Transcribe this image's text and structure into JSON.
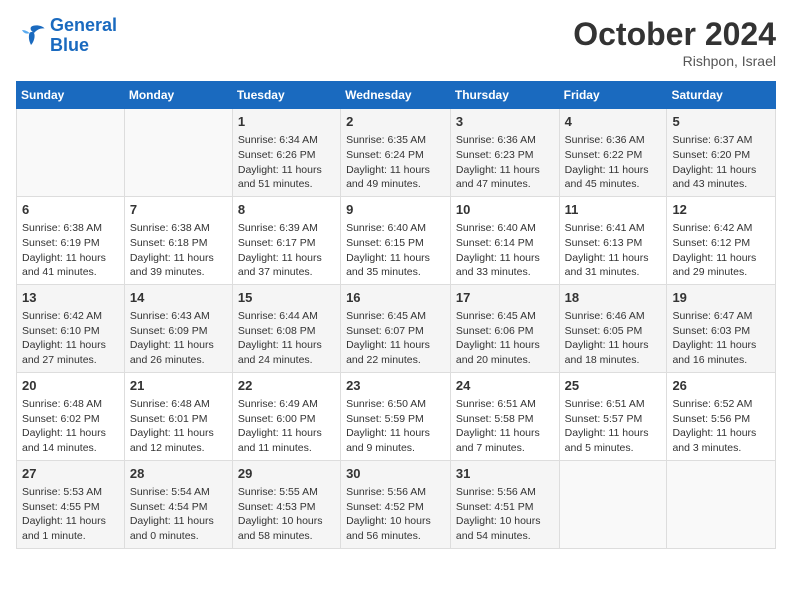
{
  "header": {
    "logo_line1": "General",
    "logo_line2": "Blue",
    "month_year": "October 2024",
    "location": "Rishpon, Israel"
  },
  "weekdays": [
    "Sunday",
    "Monday",
    "Tuesday",
    "Wednesday",
    "Thursday",
    "Friday",
    "Saturday"
  ],
  "weeks": [
    [
      {
        "day": "",
        "content": ""
      },
      {
        "day": "",
        "content": ""
      },
      {
        "day": "1",
        "content": "Sunrise: 6:34 AM\nSunset: 6:26 PM\nDaylight: 11 hours and 51 minutes."
      },
      {
        "day": "2",
        "content": "Sunrise: 6:35 AM\nSunset: 6:24 PM\nDaylight: 11 hours and 49 minutes."
      },
      {
        "day": "3",
        "content": "Sunrise: 6:36 AM\nSunset: 6:23 PM\nDaylight: 11 hours and 47 minutes."
      },
      {
        "day": "4",
        "content": "Sunrise: 6:36 AM\nSunset: 6:22 PM\nDaylight: 11 hours and 45 minutes."
      },
      {
        "day": "5",
        "content": "Sunrise: 6:37 AM\nSunset: 6:20 PM\nDaylight: 11 hours and 43 minutes."
      }
    ],
    [
      {
        "day": "6",
        "content": "Sunrise: 6:38 AM\nSunset: 6:19 PM\nDaylight: 11 hours and 41 minutes."
      },
      {
        "day": "7",
        "content": "Sunrise: 6:38 AM\nSunset: 6:18 PM\nDaylight: 11 hours and 39 minutes."
      },
      {
        "day": "8",
        "content": "Sunrise: 6:39 AM\nSunset: 6:17 PM\nDaylight: 11 hours and 37 minutes."
      },
      {
        "day": "9",
        "content": "Sunrise: 6:40 AM\nSunset: 6:15 PM\nDaylight: 11 hours and 35 minutes."
      },
      {
        "day": "10",
        "content": "Sunrise: 6:40 AM\nSunset: 6:14 PM\nDaylight: 11 hours and 33 minutes."
      },
      {
        "day": "11",
        "content": "Sunrise: 6:41 AM\nSunset: 6:13 PM\nDaylight: 11 hours and 31 minutes."
      },
      {
        "day": "12",
        "content": "Sunrise: 6:42 AM\nSunset: 6:12 PM\nDaylight: 11 hours and 29 minutes."
      }
    ],
    [
      {
        "day": "13",
        "content": "Sunrise: 6:42 AM\nSunset: 6:10 PM\nDaylight: 11 hours and 27 minutes."
      },
      {
        "day": "14",
        "content": "Sunrise: 6:43 AM\nSunset: 6:09 PM\nDaylight: 11 hours and 26 minutes."
      },
      {
        "day": "15",
        "content": "Sunrise: 6:44 AM\nSunset: 6:08 PM\nDaylight: 11 hours and 24 minutes."
      },
      {
        "day": "16",
        "content": "Sunrise: 6:45 AM\nSunset: 6:07 PM\nDaylight: 11 hours and 22 minutes."
      },
      {
        "day": "17",
        "content": "Sunrise: 6:45 AM\nSunset: 6:06 PM\nDaylight: 11 hours and 20 minutes."
      },
      {
        "day": "18",
        "content": "Sunrise: 6:46 AM\nSunset: 6:05 PM\nDaylight: 11 hours and 18 minutes."
      },
      {
        "day": "19",
        "content": "Sunrise: 6:47 AM\nSunset: 6:03 PM\nDaylight: 11 hours and 16 minutes."
      }
    ],
    [
      {
        "day": "20",
        "content": "Sunrise: 6:48 AM\nSunset: 6:02 PM\nDaylight: 11 hours and 14 minutes."
      },
      {
        "day": "21",
        "content": "Sunrise: 6:48 AM\nSunset: 6:01 PM\nDaylight: 11 hours and 12 minutes."
      },
      {
        "day": "22",
        "content": "Sunrise: 6:49 AM\nSunset: 6:00 PM\nDaylight: 11 hours and 11 minutes."
      },
      {
        "day": "23",
        "content": "Sunrise: 6:50 AM\nSunset: 5:59 PM\nDaylight: 11 hours and 9 minutes."
      },
      {
        "day": "24",
        "content": "Sunrise: 6:51 AM\nSunset: 5:58 PM\nDaylight: 11 hours and 7 minutes."
      },
      {
        "day": "25",
        "content": "Sunrise: 6:51 AM\nSunset: 5:57 PM\nDaylight: 11 hours and 5 minutes."
      },
      {
        "day": "26",
        "content": "Sunrise: 6:52 AM\nSunset: 5:56 PM\nDaylight: 11 hours and 3 minutes."
      }
    ],
    [
      {
        "day": "27",
        "content": "Sunrise: 5:53 AM\nSunset: 4:55 PM\nDaylight: 11 hours and 1 minute."
      },
      {
        "day": "28",
        "content": "Sunrise: 5:54 AM\nSunset: 4:54 PM\nDaylight: 11 hours and 0 minutes."
      },
      {
        "day": "29",
        "content": "Sunrise: 5:55 AM\nSunset: 4:53 PM\nDaylight: 10 hours and 58 minutes."
      },
      {
        "day": "30",
        "content": "Sunrise: 5:56 AM\nSunset: 4:52 PM\nDaylight: 10 hours and 56 minutes."
      },
      {
        "day": "31",
        "content": "Sunrise: 5:56 AM\nSunset: 4:51 PM\nDaylight: 10 hours and 54 minutes."
      },
      {
        "day": "",
        "content": ""
      },
      {
        "day": "",
        "content": ""
      }
    ]
  ]
}
